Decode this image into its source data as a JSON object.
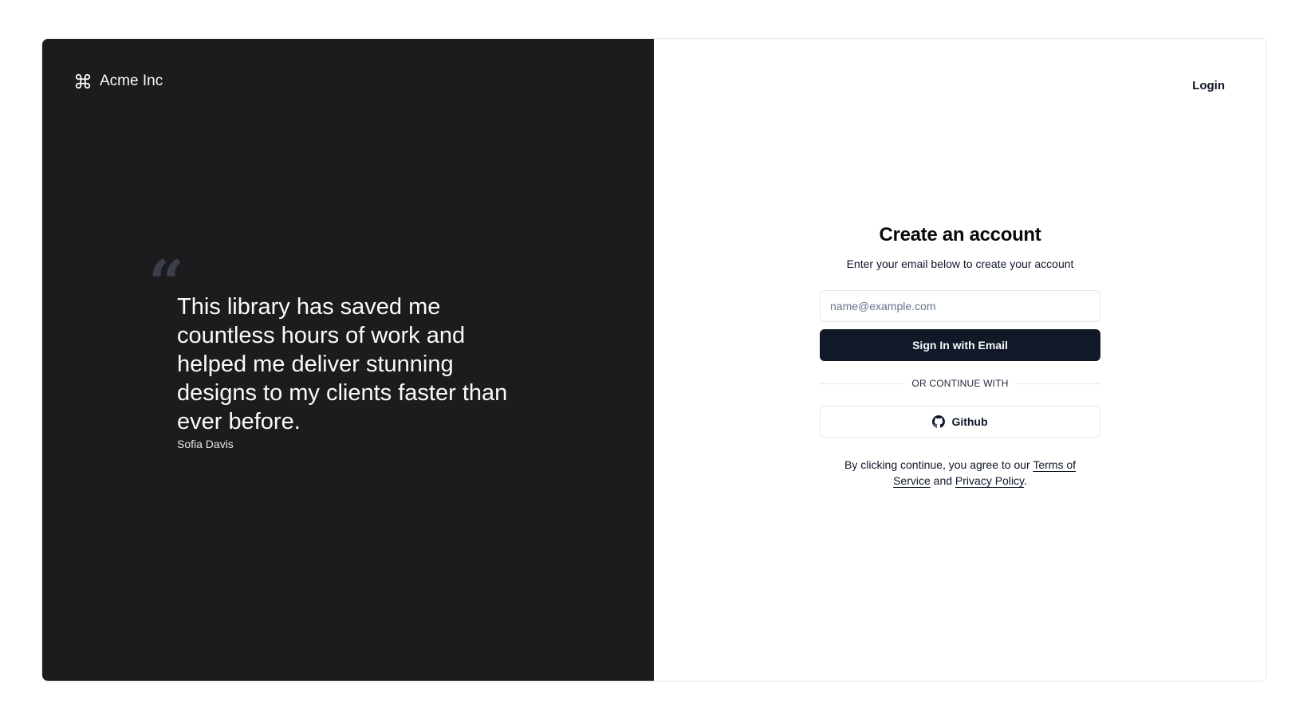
{
  "brand": {
    "name": "Acme Inc",
    "icon": "command-icon"
  },
  "testimonial": {
    "quote_mark": "“",
    "quote": "This library has saved me countless hours of work and helped me deliver stunning designs to my clients faster than ever before.",
    "author": "Sofia Davis"
  },
  "header": {
    "login_label": "Login"
  },
  "form": {
    "title": "Create an account",
    "subtitle": "Enter your email below to create your account",
    "email_placeholder": "name@example.com",
    "email_value": "",
    "submit_label": "Sign In with Email",
    "divider_label": "Or continue with",
    "github_label": "Github",
    "github_icon": "github-icon"
  },
  "terms": {
    "prefix": "By clicking continue, you agree to our ",
    "terms_label": "Terms of Service",
    "middle": " and ",
    "privacy_label": "Privacy Policy",
    "suffix": "."
  },
  "colors": {
    "left_panel_bg": "#1c1c1e",
    "primary_button_bg": "#111827",
    "quote_mark": "#3a3f4b"
  }
}
